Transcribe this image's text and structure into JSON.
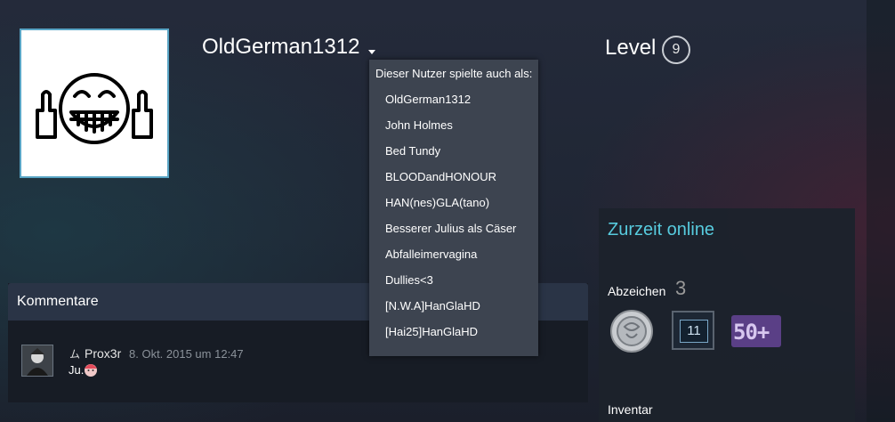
{
  "profile": {
    "persona_name": "OldGerman1312",
    "level_label": "Level",
    "level_value": "9"
  },
  "alias_dropdown": {
    "header": "Dieser Nutzer spielte auch als:",
    "items": [
      "OldGerman1312",
      "John Holmes",
      "Bed Tundy",
      "BLOODandHONOUR",
      "HAN(nes)GLA(tano)",
      "Besserer Julius als Cäser",
      "Abfalleimervagina",
      "Dullies<3",
      "[N.W.A]HanGlaHD",
      "[Hai25]HanGlaHD"
    ]
  },
  "sidebar": {
    "online_status": "Zurzeit online",
    "badges_label": "Abzeichen",
    "badges_count": "3",
    "badges": [
      {
        "icon": "silver-coin-badge-icon"
      },
      {
        "icon": "years-of-service-badge-icon",
        "text": "11"
      },
      {
        "icon": "games-owned-badge-icon",
        "text": "50+"
      }
    ],
    "inventory_label": "Inventar"
  },
  "comments": {
    "title": "Kommentare",
    "items": [
      {
        "author_icon": "ム",
        "author": "Prox3r",
        "timestamp": "8. Okt. 2015 um 12:47",
        "text": "Ju."
      }
    ]
  },
  "colors": {
    "accent_online": "#57cbde",
    "avatar_border": "#58a4c4",
    "dropdown_bg": "#3d4450"
  }
}
